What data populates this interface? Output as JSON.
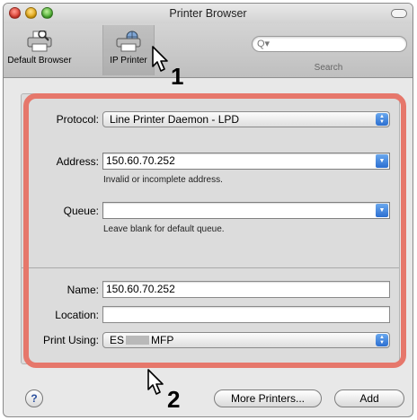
{
  "window": {
    "title": "Printer Browser"
  },
  "toolbar": {
    "tools": [
      {
        "label": "Default Browser",
        "icon": "printer-icon"
      },
      {
        "label": "IP Printer",
        "icon": "globe-printer-icon"
      }
    ],
    "search": {
      "icon": "search-icon",
      "label": "Search",
      "glyph": "Q▾"
    }
  },
  "form": {
    "protocol": {
      "label": "Protocol:",
      "value": "Line Printer Daemon - LPD"
    },
    "address": {
      "label": "Address:",
      "value": "150.60.70.252",
      "hint": "Invalid or incomplete address."
    },
    "queue": {
      "label": "Queue:",
      "value": "",
      "hint": "Leave blank for default queue."
    },
    "name": {
      "label": "Name:",
      "value": "150.60.70.252"
    },
    "location": {
      "label": "Location:",
      "value": ""
    },
    "print_using": {
      "label": "Print Using:",
      "value_prefix": "ES",
      "value_suffix": "MFP"
    }
  },
  "buttons": {
    "help": "?",
    "more_printers": "More Printers...",
    "add": "Add"
  },
  "callouts": {
    "one": "1",
    "two": "2"
  },
  "colors": {
    "highlight": "#e6776b",
    "accent_blue": "#2c6fd1"
  }
}
